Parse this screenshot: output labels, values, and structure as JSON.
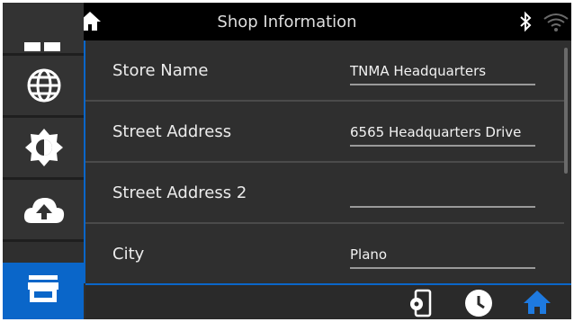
{
  "header": {
    "title": "Shop Information",
    "left_icons": [
      "back-arrow-icon",
      "home-icon"
    ],
    "right_icons": [
      "bluetooth-icon",
      "wifi-icon"
    ]
  },
  "sidebar": {
    "items": [
      {
        "icon": "user-icon",
        "active": false
      },
      {
        "icon": "globe-icon",
        "active": false
      },
      {
        "icon": "brightness-icon",
        "active": false
      },
      {
        "icon": "cloud-upload-icon",
        "active": false
      },
      {
        "icon": "shop-icon",
        "active": true
      }
    ]
  },
  "fields": [
    {
      "label": "Store Name",
      "value": "TNMA Headquarters"
    },
    {
      "label": "Street Address",
      "value": "6565 Headquarters Drive"
    },
    {
      "label": "Street Address 2",
      "value": ""
    },
    {
      "label": "City",
      "value": "Plano"
    }
  ],
  "bottom_icons": [
    "device-settings-icon",
    "history-clock-icon",
    "home-icon"
  ],
  "colors": {
    "accent": "#0a66c9",
    "topbar": "#000000",
    "background": "#2f2f2f"
  }
}
